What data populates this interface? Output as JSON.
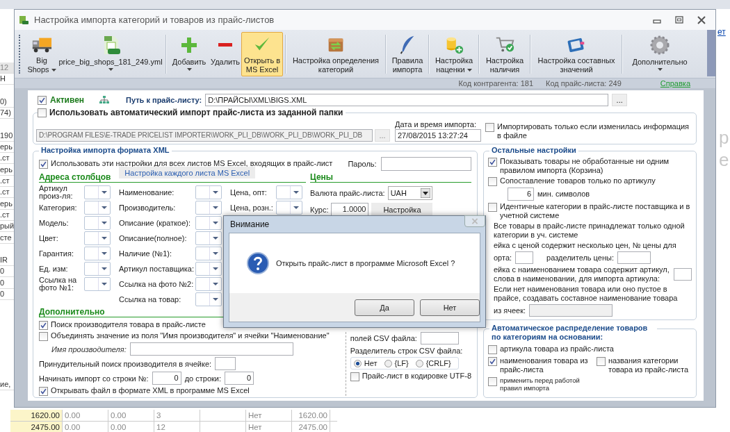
{
  "window": {
    "title": "Настройка импорта категорий и товаров из прайс-листов"
  },
  "toolbar": [
    {
      "label": "Big Shops",
      "dropdown": true,
      "selected": false
    },
    {
      "label": "price_big_shops_181_249.yml",
      "dropdown": true,
      "selected": false
    },
    {
      "label": "Добавить",
      "dropdown": true,
      "selected": false
    },
    {
      "label": "Удалить",
      "selected": false
    },
    {
      "label": "Открыть в MS Excel",
      "selected": true
    },
    {
      "label": "Настройка определения категорий",
      "selected": false
    },
    {
      "label": "Правила импорта",
      "selected": false
    },
    {
      "label": "Настройка наценки",
      "dropdown": true,
      "selected": false
    },
    {
      "label": "Настройка наличия",
      "selected": false
    },
    {
      "label": "Настройка составных значений",
      "selected": false
    },
    {
      "label": "Дополнительно",
      "dropdown": true,
      "selected": false
    }
  ],
  "status_bar": {
    "counterparty_code": "Код контрагента: 181",
    "price_list_code": "Код прайс-листа: 249",
    "help_link": "Справка"
  },
  "source": {
    "active": {
      "label": "Активен",
      "checked": true
    },
    "path_label": "Путь к прайс-листу:",
    "path_value": "D:\\ПРАЙСЫ\\XML\\BIGS.XML",
    "browse_button": "..."
  },
  "auto_import": {
    "label": "Использовать автоматический импорт прайс-листа из заданной папки",
    "checked": false,
    "folder_value": "D:\\PROGRAM FILES\\E-TRADE PRICELIST IMPORTER\\WORK_PLI_DB\\WORK_PLI_DB\\WORK_PLI_DB",
    "browse_button": "...",
    "date_label": "Дата и время импорта:",
    "date_value": "27/08/2015 13:27:24",
    "only_if_changed": {
      "label": "Импортировать только если изменилась информация в файле",
      "checked": false
    }
  },
  "xml_settings": {
    "title": "Настройка импорта формата XML",
    "all_sheets": {
      "label": "Использовать эти настройки для всех листов MS Excel, входящих в прайс-лист",
      "checked": true
    },
    "password_label": "Пароль:",
    "per_sheet_button": "Настройка каждого листа MS Excel",
    "columns_title": "Адреса столбцов",
    "column_fields": [
      [
        {
          "label": "Артикул произ-ля:"
        },
        {
          "label": "Категория:"
        },
        {
          "label": "Модель:"
        },
        {
          "label": "Цвет:"
        },
        {
          "label": "Гарантия:"
        },
        {
          "label": "Ед. изм:"
        },
        {
          "label": "Ссылка на фото №1:"
        }
      ],
      [
        {
          "label": "Наименование:"
        },
        {
          "label": "Производитель:"
        },
        {
          "label": "Описание (краткое):"
        },
        {
          "label": "Описание(полное):"
        },
        {
          "label": "Наличие (№1):"
        },
        {
          "label": "Артикул поставщика:"
        },
        {
          "label": "Ссылка на фото №2:"
        },
        {
          "label": "Ссылка на товар:"
        }
      ],
      [
        {
          "label": "Цена, опт:"
        },
        {
          "label": "Цена, розн.:"
        }
      ]
    ],
    "prices": {
      "title": "Цены",
      "currency_label": "Валюта прайс-листа:",
      "currency_value": "UAH",
      "rate_label": "Курс:",
      "rate_value": "1.0000",
      "settings_button": "Настройка"
    },
    "extra": {
      "title": "Дополнительно",
      "options": [
        {
          "label": "Поиск производителя товара в прайс-листе",
          "checked": true
        },
        {
          "label": "Объединять значение из поля \"Имя производителя\" и ячейки \"Наименование\"",
          "checked": false
        }
      ],
      "maker_name_label": "Имя производителя:",
      "forced_search_label": "Принудительный поиск производителя в ячейке:",
      "start_row_label": "Начинать импорт со строки №:",
      "start_row_value": "0",
      "end_row_label": "до строки:",
      "end_row_value": "0",
      "open_in_excel": {
        "label": "Открывать файл в формате XML в программе MS Excel",
        "checked": true
      }
    },
    "csv": {
      "field_label": "полей CSV файла:",
      "row_separator_label": "Разделитель строк CSV файла:",
      "separators": [
        {
          "label": "Нет",
          "selected": true
        },
        {
          "label": "{LF}",
          "selected": false
        },
        {
          "label": "{CRLF}",
          "selected": false
        }
      ],
      "utf8": {
        "label": "Прайс-лист в кодировке UTF-8",
        "checked": false
      }
    }
  },
  "other_settings": {
    "title": "Остальные настройки",
    "items": [
      {
        "kind": "checkbox",
        "label": "Показывать товары не обработанные ни одним правилом импорта (Корзина)",
        "checked": true
      },
      {
        "kind": "checkbox_min",
        "label": "Сопоставление товаров только по артикулу",
        "checked": false,
        "value": "6",
        "value_label": "мин. символов"
      },
      {
        "kind": "checkbox",
        "label": "Идентичные категории в прайс-листе поставщика и в учетной системе",
        "checked": false
      },
      {
        "kind": "text",
        "label": "Все товары в прайс-листе принадлежат только одной категории в уч. системе"
      },
      {
        "kind": "price_index",
        "label": "ейка с ценой содержит несколько цен, № цены для",
        "label_2": "орта:",
        "separator_label": "разделитель цены:"
      },
      {
        "kind": "article_words",
        "label": "ейка с наименованием товара содержит артикул,",
        "label_2": "слова в наименовании, для импорта артикула:"
      },
      {
        "kind": "compose_name",
        "label": "Если нет наименования товара или оно пустое в прайсе, создавать составное наименование товара",
        "label_2": "из ячеек:"
      }
    ]
  },
  "auto_distribution": {
    "title": "Автоматическое распределение товаров по категориям на основании:",
    "options": [
      {
        "label": "артикула товара из прайс-листа",
        "checked": false
      },
      {
        "label": "наименования товара из прайс-листа",
        "checked": true
      },
      {
        "label": "названия  категории товара из прайс-листа",
        "checked": false
      },
      {
        "label": "применить перед работой правил импорта",
        "checked": false
      }
    ]
  },
  "dialog": {
    "title": "Внимание",
    "message": "Открыть прайс-лист в программе Microsoft Excel ?",
    "buttons": [
      "Да",
      "Нет"
    ]
  },
  "background_sheet": {
    "fragments": [
      "12",
      "Н",
      "0)",
      "74)",
      "190",
      "ерь",
      ".ст",
      "ерь",
      ".ст",
      ".ст",
      "ерь",
      ".ст",
      "рый",
      "сте",
      "IR",
      "0",
      "0",
      "0",
      "ие,"
    ],
    "rows": [
      {
        "cells": [
          "1620.00",
          "0.00",
          "0.00",
          "3"
        ],
        "status": "Нет",
        "total": "1620.00"
      },
      {
        "cells": [
          "2475.00",
          "0.00",
          "0.00",
          "12"
        ],
        "status": "Нет",
        "total": "2475.00"
      }
    ]
  },
  "side_window": {
    "link": "ет",
    "text_1": "р",
    "text_2": "е"
  }
}
